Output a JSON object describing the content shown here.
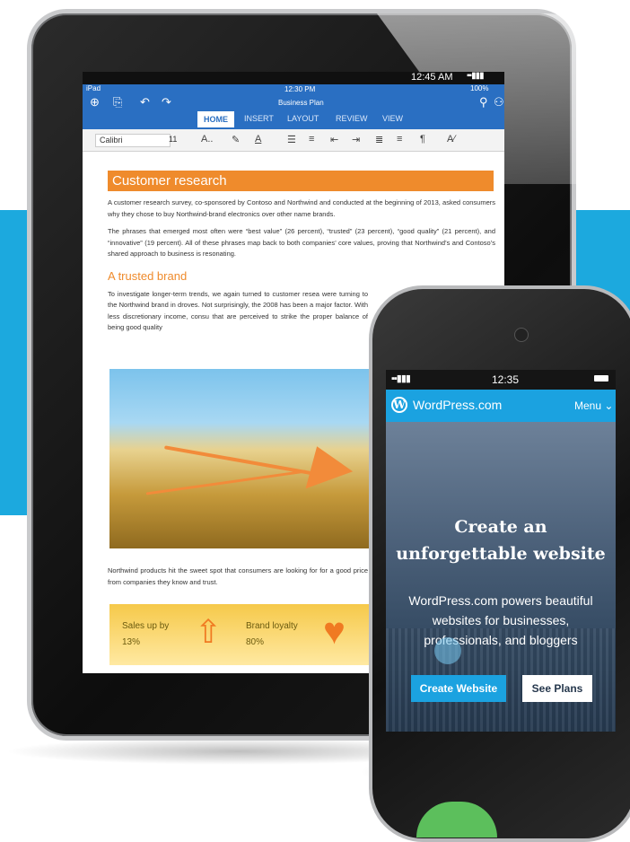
{
  "tablet": {
    "status_time": "12:45 AM",
    "signal": "▪▪▮▮▮",
    "device": "iPad",
    "clock": "12:30 PM",
    "battery": "100%",
    "doc_title": "Business Plan",
    "tabs": [
      "HOME",
      "INSERT",
      "LAYOUT",
      "REVIEW",
      "VIEW"
    ],
    "font_name": "Calibri",
    "font_size": "11",
    "document": {
      "heading": "Customer research",
      "para1": "A customer research survey, co-sponsored by Contoso and Northwind and conducted at the beginning of 2013, asked consumers why they chose to buy Northwind-brand electronics over other name brands.",
      "para2": "The phrases that emerged most often were “best value” (26 percent), “trusted” (23 percent), “good quality” (21 percent), and “innovative” (19 percent). All of these phrases map back to both companies’ core values, proving that Northwind’s and Contoso’s shared approach to business is resonating.",
      "subheading": "A trusted brand",
      "para3": "To investigate longer-term trends, we again turned to customer resea were turning to the Northwind brand in droves. Not surprisingly, the 2008 has been a major factor. With less discretionary income, consu that are perceived to strike the proper balance of being good quality",
      "para4": "Northwind products hit the sweet spot that consumers are looking for for a good price from companies they know and trust.",
      "stat1_label": "Sales up by",
      "stat1_value": "13%",
      "stat2_label": "Brand loyalty",
      "stat2_value": "80%"
    }
  },
  "phone": {
    "signal": "▪▪▮▮▮",
    "time": "12:35",
    "brand": "WordPress.com",
    "logo_letter": "W",
    "menu": "Menu ⌄",
    "hero_title_line1": "Create an",
    "hero_title_line2": "unforgettable website",
    "hero_sub": "WordPress.com powers beautiful websites for businesses, professionals, and bloggers",
    "btn_create": "Create Website",
    "btn_plans": "See Plans"
  },
  "colors": {
    "cyan": "#1ca9de",
    "word_blue": "#2a6fc2",
    "orange": "#ef8b2c",
    "wp_blue": "#1ba2e0"
  }
}
